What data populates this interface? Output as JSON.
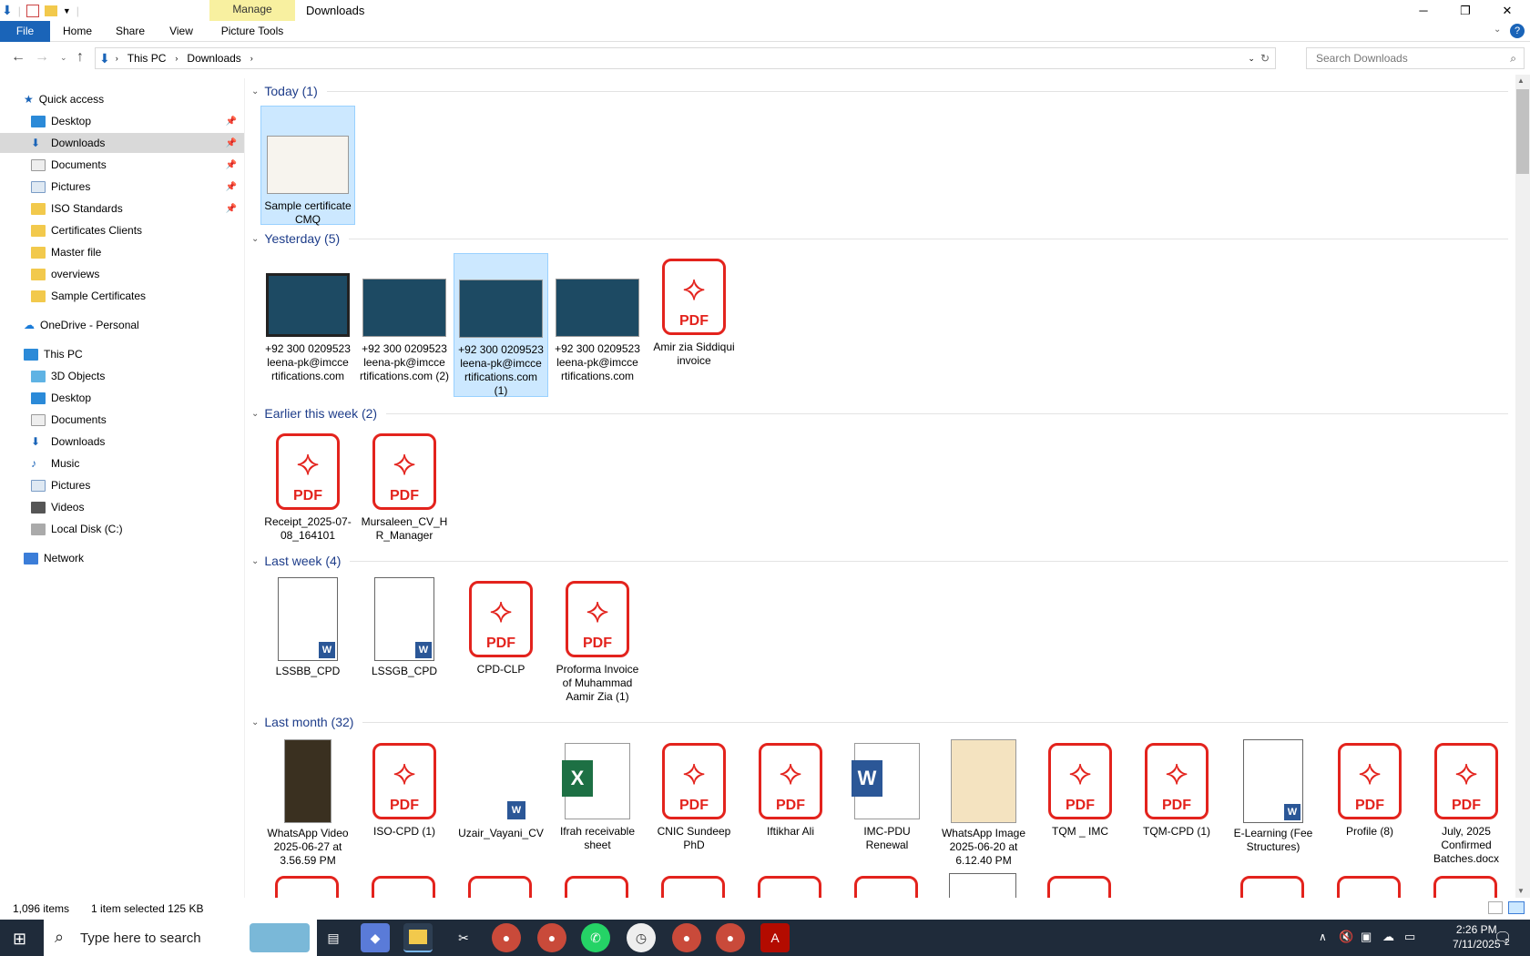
{
  "window": {
    "title": "Downloads",
    "manage_label": "Manage"
  },
  "ribbon": {
    "tabs": [
      "File",
      "Home",
      "Share",
      "View",
      "Picture Tools"
    ]
  },
  "address": {
    "crumbs": [
      "This PC",
      "Downloads"
    ],
    "search_placeholder": "Search Downloads"
  },
  "sidebar": {
    "quick_access": "Quick access",
    "items": [
      {
        "label": "Desktop",
        "pinned": true
      },
      {
        "label": "Downloads",
        "pinned": true,
        "selected": true
      },
      {
        "label": "Documents",
        "pinned": true
      },
      {
        "label": "Pictures",
        "pinned": true
      },
      {
        "label": "ISO Standards",
        "pinned": true
      },
      {
        "label": "Certificates Clients"
      },
      {
        "label": "Master file"
      },
      {
        "label": "overviews"
      },
      {
        "label": "Sample Certificates"
      }
    ],
    "onedrive": "OneDrive - Personal",
    "this_pc": "This PC",
    "pc_items": [
      "3D Objects",
      "Desktop",
      "Documents",
      "Downloads",
      "Music",
      "Pictures",
      "Videos",
      "Local Disk (C:)"
    ],
    "network": "Network"
  },
  "groups": [
    {
      "header": "Today (1)",
      "files": [
        "Sample certificate CMQ"
      ]
    },
    {
      "header": "Yesterday (5)",
      "files": [
        "+92 300 0209523 leena-pk@imcce rtifications.com",
        "+92 300 0209523 leena-pk@imcce rtifications.com (2)",
        "+92 300 0209523 leena-pk@imcce rtifications.com (1)",
        "+92 300 0209523 leena-pk@imcce rtifications.com",
        "Amir zia Siddiqui invoice"
      ]
    },
    {
      "header": "Earlier this week (2)",
      "files": [
        "Receipt_2025-07-08_164101",
        "Mursaleen_CV_H R_Manager"
      ]
    },
    {
      "header": "Last week (4)",
      "files": [
        "LSSBB_CPD",
        "LSSGB_CPD",
        "CPD-CLP",
        "Proforma Invoice of Muhammad Aamir Zia (1)"
      ]
    },
    {
      "header": "Last month (32)",
      "files": [
        "WhatsApp Video 2025-06-27 at 3.56.59 PM",
        "ISO-CPD (1)",
        "Uzair_Vayani_CV",
        "Ifrah receivable sheet",
        "CNIC Sundeep PhD",
        "Iftikhar Ali",
        "IMC-PDU Renewal",
        "WhatsApp Image 2025-06-20 at 6.12.40 PM",
        "TQM _ IMC",
        "TQM-CPD (1)",
        "E-Learning (Fee Structures)",
        "Profile (8)",
        "July, 2025 Confirmed Batches.docx"
      ]
    }
  ],
  "pdf_label": "PDF",
  "status": {
    "items": "1,096 items",
    "selection": "1 item selected  125 KB"
  },
  "taskbar": {
    "search_placeholder": "Type here to search",
    "time": "2:26 PM",
    "date": "7/11/2025",
    "notifications": "2"
  }
}
